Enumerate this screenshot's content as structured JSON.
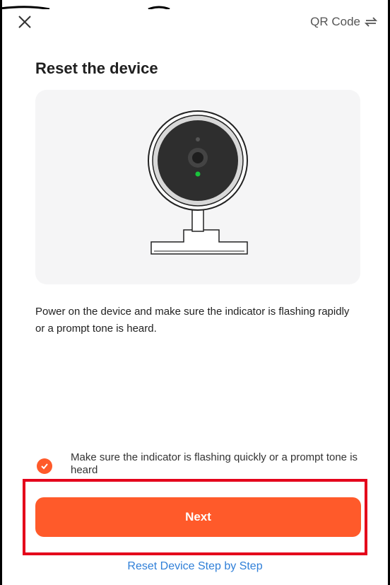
{
  "header": {
    "close_icon": "close-icon",
    "qr_label": "QR Code",
    "qr_icon": "switch-arrows-icon"
  },
  "page": {
    "title": "Reset the device",
    "description": "Power on the device and make sure the indicator is flashing rapidly or a prompt tone is heard."
  },
  "confirmation": {
    "checked": true,
    "label": "Make sure the indicator is flashing quickly or a prompt tone is heard"
  },
  "actions": {
    "next_label": "Next",
    "reset_link_label": "Reset Device Step by Step"
  },
  "colors": {
    "accent": "#ff5a2a",
    "link": "#2f7fd8",
    "highlight_outline": "#e4001b",
    "indicator_light": "#19c43c"
  }
}
